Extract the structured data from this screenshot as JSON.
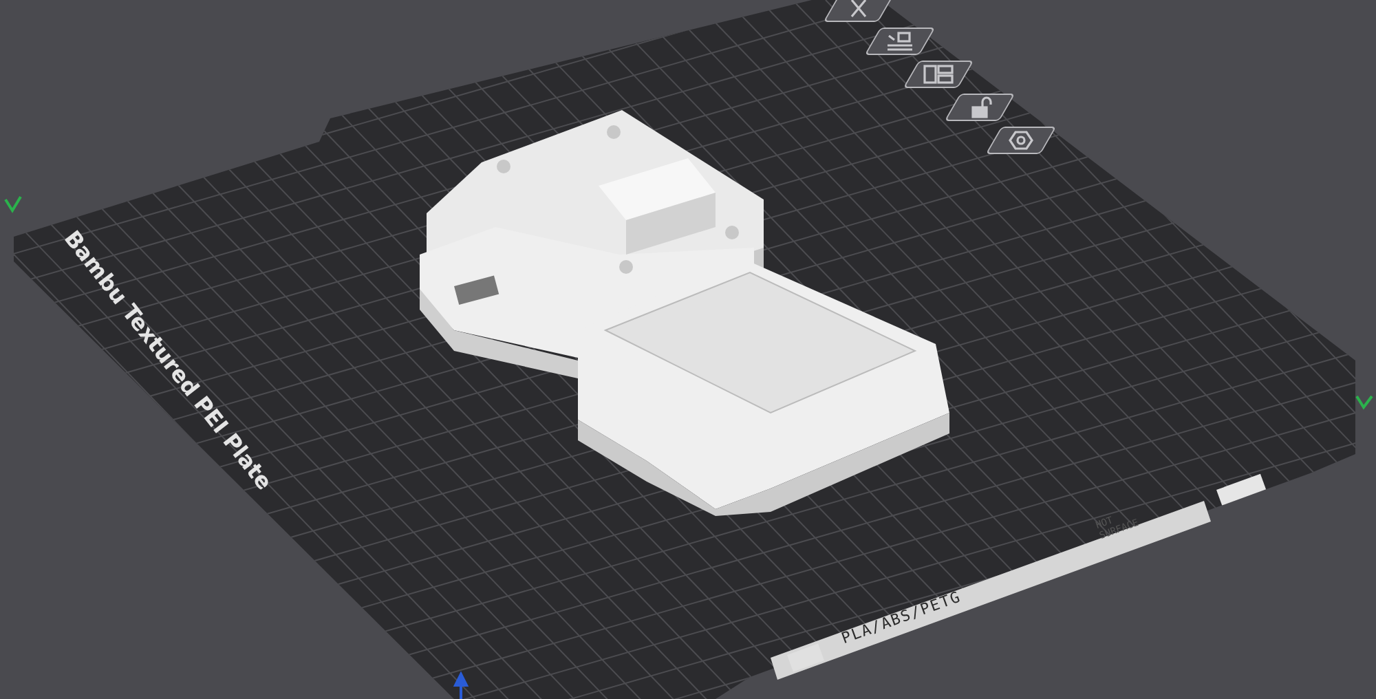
{
  "plate": {
    "name": "Bambu Textured PEI Plate",
    "materials": "PLA/ABS/PETG",
    "warning": [
      "HOT",
      "SURFACE"
    ]
  },
  "plate_tools": [
    {
      "kind": "close"
    },
    {
      "kind": "arrange"
    },
    {
      "kind": "layout"
    },
    {
      "kind": "lock",
      "locked": false
    },
    {
      "kind": "settings"
    }
  ]
}
